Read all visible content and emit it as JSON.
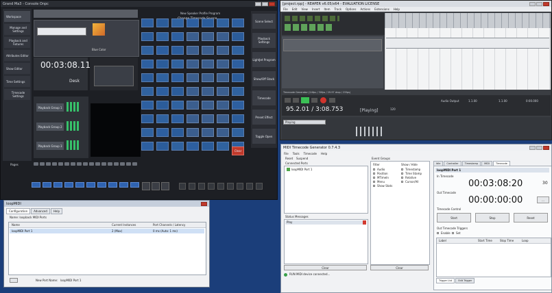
{
  "console": {
    "title": "Grand Ma3 - Console Onpc",
    "sidebar": [
      "Workspace",
      "Manage and Settings",
      "Playback and Fixtures",
      "Attributes Editor",
      "Show Editor",
      "Time Settings",
      "Timecode Settings"
    ],
    "timer": "00:03:08.11",
    "timer_label": "Desk",
    "preset_label": "Blue Color",
    "header_right": [
      "New Speaker Profile Program",
      "Change Timecode Source"
    ],
    "right_panel": [
      "Scene Select",
      "Playback Settings",
      "LightJet Program",
      "Show/Off Stack",
      "Timecode",
      "Preset Effect",
      "Toggle Open"
    ],
    "playback_groups": [
      "Playback Group 1",
      "Playback Group 2",
      "Playback Group 3"
    ],
    "pages_label": "Pages",
    "clear_btn": "Clear"
  },
  "reaper": {
    "title": "[project.rpp] - REAPER v6.05/x64 - EVALUATION LICENSE",
    "menu": [
      "File",
      "Edit",
      "View",
      "Insert",
      "Item",
      "Track",
      "Options",
      "Actions",
      "Extensions",
      "Help"
    ],
    "transport_time": "95.2.01 / 3:08.753",
    "transport_state": "[Playing]",
    "tempo": "120",
    "dropdown": "Playing",
    "status": "Timecode Generator (24fps / 30fps / 29.97 drop / 25fps)",
    "right_readout": [
      "Audio Output",
      "1.1.00",
      "1.1.00",
      "0:00.000"
    ]
  },
  "midi": {
    "title": "loopMIDI",
    "tabs": [
      "Configuration",
      "Advanced",
      "Help"
    ],
    "section": "Name: loopback MIDI Ports",
    "columns": [
      "Name",
      "Current Instances",
      "Port Channels / Latency"
    ],
    "rows": [
      {
        "name": "loopMIDI Port 1",
        "instances": "2 (Max)",
        "latency": "0 ms (Auto: 1 ms)"
      }
    ],
    "footer_label": "New Port Name:",
    "footer_value": "loopMIDI Port 1"
  },
  "timecode": {
    "title": "MIDI Timecode Generator 0.7.4.3",
    "menu": [
      "File",
      "Tools",
      "Timecode",
      "Help"
    ],
    "left_toolbar": [
      "Reset",
      "Suspend"
    ],
    "left_section": "Connected Ports",
    "port": "loopMIDI Port 1",
    "messages_label": "Status Messages",
    "messages_value": "Play",
    "events_label": "Event Groups",
    "filter_label": "Filter",
    "filter_items": [
      "Audio",
      "Position",
      "MTimeIn",
      "Menu",
      "Show Stats"
    ],
    "show_label": "Show / Hide",
    "show_items": [
      "Timestamp",
      "Time Stamp",
      "Relative",
      "Cursor/All"
    ],
    "tabs": [
      "Idle",
      "Controller",
      "Timestamp",
      "MIDI",
      "Timecode"
    ],
    "device": "loopMIDI Port 1",
    "in_label": "In Timecode",
    "in_value": "00:03:08:20",
    "in_fps": "30",
    "out_label": "Out Timecode",
    "out_value": "00:00:00:00",
    "out_btn": "...",
    "control_label": "Timecode Control",
    "control_buttons": [
      "Start",
      "Stop",
      "Reset"
    ],
    "triggers_label": "Out Timecode Triggers",
    "trigger_opts": [
      "Enable",
      "Set"
    ],
    "table_cols": [
      "Label",
      "Start Time",
      "Stop Time",
      "Loop"
    ],
    "bottom_tabs": [
      "Trigger List",
      "Edit Trigger"
    ],
    "clear_left": "Clear",
    "clear_right": "Clear",
    "status": "RUN MIDI device connected..."
  }
}
